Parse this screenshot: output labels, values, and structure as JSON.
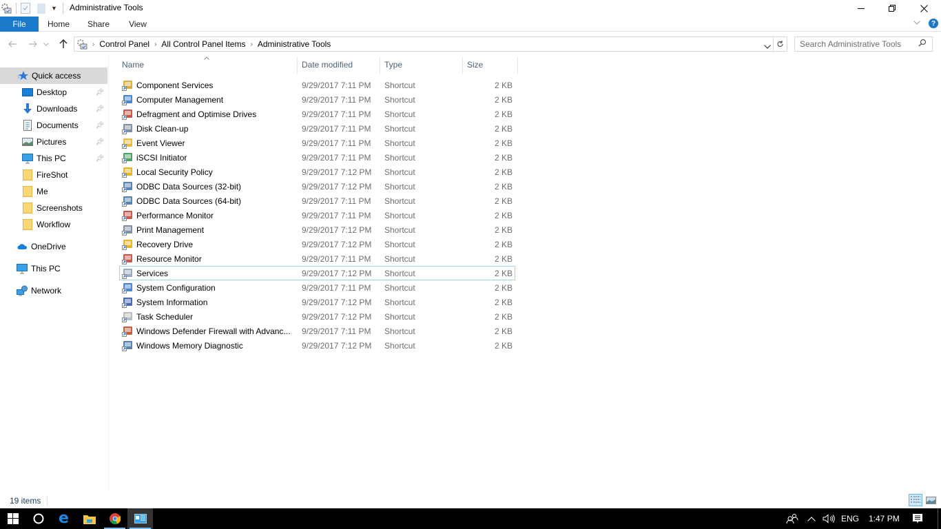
{
  "window": {
    "title": "Administrative Tools",
    "controls": {
      "minimize": "—",
      "restore": "❐",
      "close": "✕"
    }
  },
  "ribbon": {
    "tabs": [
      {
        "label": "File",
        "active": true
      },
      {
        "label": "Home"
      },
      {
        "label": "Share"
      },
      {
        "label": "View"
      }
    ]
  },
  "address": {
    "crumbs": [
      "Control Panel",
      "All Control Panel Items",
      "Administrative Tools"
    ],
    "search_placeholder": "Search Administrative Tools"
  },
  "nav": {
    "quick_access": {
      "label": "Quick access",
      "selected": true
    },
    "pinned": [
      {
        "label": "Desktop",
        "icon": "desktop-icon",
        "pinned": true
      },
      {
        "label": "Downloads",
        "icon": "downloads-icon",
        "pinned": true
      },
      {
        "label": "Documents",
        "icon": "documents-icon",
        "pinned": true
      },
      {
        "label": "Pictures",
        "icon": "pictures-icon",
        "pinned": true
      },
      {
        "label": "This PC",
        "icon": "this-pc-icon",
        "pinned": true
      },
      {
        "label": "FireShot",
        "icon": "folder-icon"
      },
      {
        "label": "Me",
        "icon": "folder-icon"
      },
      {
        "label": "Screenshots",
        "icon": "folder-icon"
      },
      {
        "label": "Workflow",
        "icon": "folder-icon"
      }
    ],
    "roots": [
      {
        "label": "OneDrive",
        "icon": "onedrive-icon"
      },
      {
        "label": "This PC",
        "icon": "this-pc-icon"
      },
      {
        "label": "Network",
        "icon": "network-icon"
      }
    ]
  },
  "columns": {
    "name": "Name",
    "date": "Date modified",
    "type": "Type",
    "size": "Size"
  },
  "files": [
    {
      "name": "Component Services",
      "date": "9/29/2017 7:11 PM",
      "type": "Shortcut",
      "size": "2 KB",
      "color": "#d4a017"
    },
    {
      "name": "Computer Management",
      "date": "9/29/2017 7:11 PM",
      "type": "Shortcut",
      "size": "2 KB",
      "color": "#2a6fc9"
    },
    {
      "name": "Defragment and Optimise Drives",
      "date": "9/29/2017 7:11 PM",
      "type": "Shortcut",
      "size": "2 KB",
      "color": "#c0392b"
    },
    {
      "name": "Disk Clean-up",
      "date": "9/29/2017 7:11 PM",
      "type": "Shortcut",
      "size": "2 KB",
      "color": "#6b7c8f"
    },
    {
      "name": "Event Viewer",
      "date": "9/29/2017 7:11 PM",
      "type": "Shortcut",
      "size": "2 KB",
      "color": "#e0b020"
    },
    {
      "name": "iSCSI Initiator",
      "date": "9/29/2017 7:11 PM",
      "type": "Shortcut",
      "size": "2 KB",
      "color": "#2f8f4f"
    },
    {
      "name": "Local Security Policy",
      "date": "9/29/2017 7:12 PM",
      "type": "Shortcut",
      "size": "2 KB",
      "color": "#e0a800"
    },
    {
      "name": "ODBC Data Sources (32-bit)",
      "date": "9/29/2017 7:12 PM",
      "type": "Shortcut",
      "size": "2 KB",
      "color": "#3b6ea5"
    },
    {
      "name": "ODBC Data Sources (64-bit)",
      "date": "9/29/2017 7:11 PM",
      "type": "Shortcut",
      "size": "2 KB",
      "color": "#3b6ea5"
    },
    {
      "name": "Performance Monitor",
      "date": "9/29/2017 7:11 PM",
      "type": "Shortcut",
      "size": "2 KB",
      "color": "#c0392b"
    },
    {
      "name": "Print Management",
      "date": "9/29/2017 7:12 PM",
      "type": "Shortcut",
      "size": "2 KB",
      "color": "#6b7c8f"
    },
    {
      "name": "Recovery Drive",
      "date": "9/29/2017 7:12 PM",
      "type": "Shortcut",
      "size": "2 KB",
      "color": "#e0a800"
    },
    {
      "name": "Resource Monitor",
      "date": "9/29/2017 7:11 PM",
      "type": "Shortcut",
      "size": "2 KB",
      "color": "#c0392b"
    },
    {
      "name": "Services",
      "date": "9/29/2017 7:12 PM",
      "type": "Shortcut",
      "size": "2 KB",
      "color": "#8a9bb0",
      "focused": true
    },
    {
      "name": "System Configuration",
      "date": "9/29/2017 7:11 PM",
      "type": "Shortcut",
      "size": "2 KB",
      "color": "#2a6fc9"
    },
    {
      "name": "System Information",
      "date": "9/29/2017 7:12 PM",
      "type": "Shortcut",
      "size": "2 KB",
      "color": "#2a4fa0"
    },
    {
      "name": "Task Scheduler",
      "date": "9/29/2017 7:12 PM",
      "type": "Shortcut",
      "size": "2 KB",
      "color": "#b0b0b0"
    },
    {
      "name": "Windows Defender Firewall with Advanc...",
      "date": "9/29/2017 7:11 PM",
      "type": "Shortcut",
      "size": "2 KB",
      "color": "#b5441f"
    },
    {
      "name": "Windows Memory Diagnostic",
      "date": "9/29/2017 7:12 PM",
      "type": "Shortcut",
      "size": "2 KB",
      "color": "#3b6ea5"
    }
  ],
  "status": {
    "item_count": "19 items"
  },
  "taskbar": {
    "tray": {
      "language": "ENG",
      "time": "1:47 PM"
    }
  },
  "colors": {
    "accent": "#1979ca",
    "selection": "#d9d9d9",
    "focus_border": "#99d1ff"
  }
}
